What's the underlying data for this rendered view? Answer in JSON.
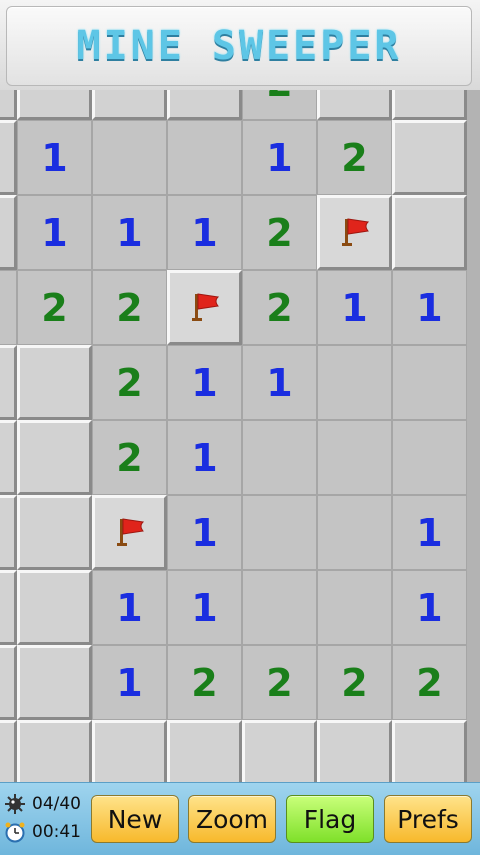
{
  "app": {
    "title": "MINE SWEEPER"
  },
  "colors": {
    "one": "#1a2de0",
    "two": "#1a7f1a",
    "flag_red": "#e0241b"
  },
  "board": {
    "legend": "H=hidden cell, E=empty opened, F=flag, digits=number of adjacent mines",
    "rows": [
      [
        "H",
        "H",
        "H",
        "H",
        "2",
        "H",
        "H"
      ],
      [
        "H",
        "1",
        "E",
        "E",
        "1",
        "2",
        "H"
      ],
      [
        "H",
        "1",
        "1",
        "1",
        "2",
        "F",
        "H"
      ],
      [
        "E",
        "2",
        "2",
        "F",
        "2",
        "1",
        "1"
      ],
      [
        "H",
        "H",
        "2",
        "1",
        "1",
        "E",
        "E"
      ],
      [
        "H",
        "H",
        "2",
        "1",
        "E",
        "E",
        "E"
      ],
      [
        "H",
        "H",
        "F",
        "1",
        "E",
        "E",
        "1"
      ],
      [
        "H",
        "H",
        "1",
        "1",
        "E",
        "E",
        "1"
      ],
      [
        "H",
        "H",
        "1",
        "2",
        "2",
        "2",
        "2"
      ],
      [
        "H",
        "H",
        "H",
        "H",
        "H",
        "H",
        "H"
      ]
    ]
  },
  "status": {
    "mines": "04/40",
    "time": "00:41"
  },
  "buttons": {
    "new": "New",
    "zoom": "Zoom",
    "flag": "Flag",
    "prefs": "Prefs"
  }
}
